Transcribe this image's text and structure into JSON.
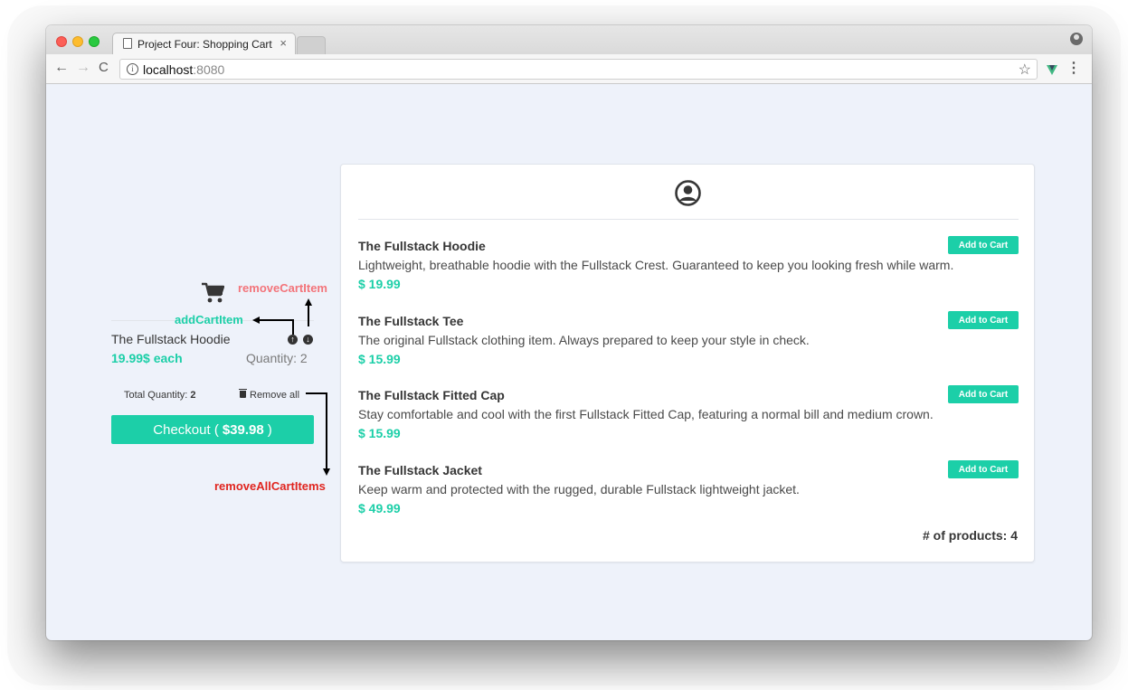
{
  "browser": {
    "tab_title": "Project Four: Shopping Cart",
    "tab_close": "×",
    "url_host": "localhost",
    "url_port": ":8080",
    "back": "←",
    "forward": "→",
    "reload": "C",
    "info": "i",
    "star": "☆",
    "menu": "⋮"
  },
  "cart": {
    "item": {
      "title": "The Fullstack Hoodie",
      "price_each": "19.99$ each",
      "quantity_label": "Quantity:",
      "quantity_value": "2",
      "up_glyph": "↑",
      "down_glyph": "↓"
    },
    "total_quantity_label": "Total Quantity:",
    "total_quantity_value": "2",
    "remove_all_label": "Remove all",
    "checkout_prefix": "Checkout (",
    "checkout_total": "$39.98",
    "checkout_suffix": ")"
  },
  "annotations": {
    "remove_cart_item": "removeCartItem",
    "add_cart_item_left": "addCartItem",
    "remove_all_cart_items": "removeAllCartItems",
    "add_cart_item_top": "addCartItem"
  },
  "products": [
    {
      "title": "The Fullstack Hoodie",
      "description": "Lightweight, breathable hoodie with the Fullstack Crest. Guaranteed to keep you looking fresh while warm.",
      "price": "$ 19.99",
      "button": "Add to Cart"
    },
    {
      "title": "The Fullstack Tee",
      "description": "The original Fullstack clothing item. Always prepared to keep your style in check.",
      "price": "$ 15.99",
      "button": "Add to Cart"
    },
    {
      "title": "The Fullstack Fitted Cap",
      "description": "Stay comfortable and cool with the first Fullstack Fitted Cap, featuring a normal bill and medium crown.",
      "price": "$ 15.99",
      "button": "Add to Cart"
    },
    {
      "title": "The Fullstack Jacket",
      "description": "Keep warm and protected with the rugged, durable Fullstack lightweight jacket.",
      "price": "$ 49.99",
      "button": "Add to Cart"
    }
  ],
  "product_count_label": "# of products: 4",
  "icons": {
    "cart": "shopping-cart-icon",
    "user": "user-circle-icon",
    "trash": "trash-icon",
    "vue": "vue-devtools-icon",
    "profile": "profile-icon"
  },
  "colors": {
    "accent": "#1ccfa8",
    "remove_annotation": "#f3747a",
    "remove_all_annotation": "#e0251f",
    "page_background": "#eef2fa"
  }
}
